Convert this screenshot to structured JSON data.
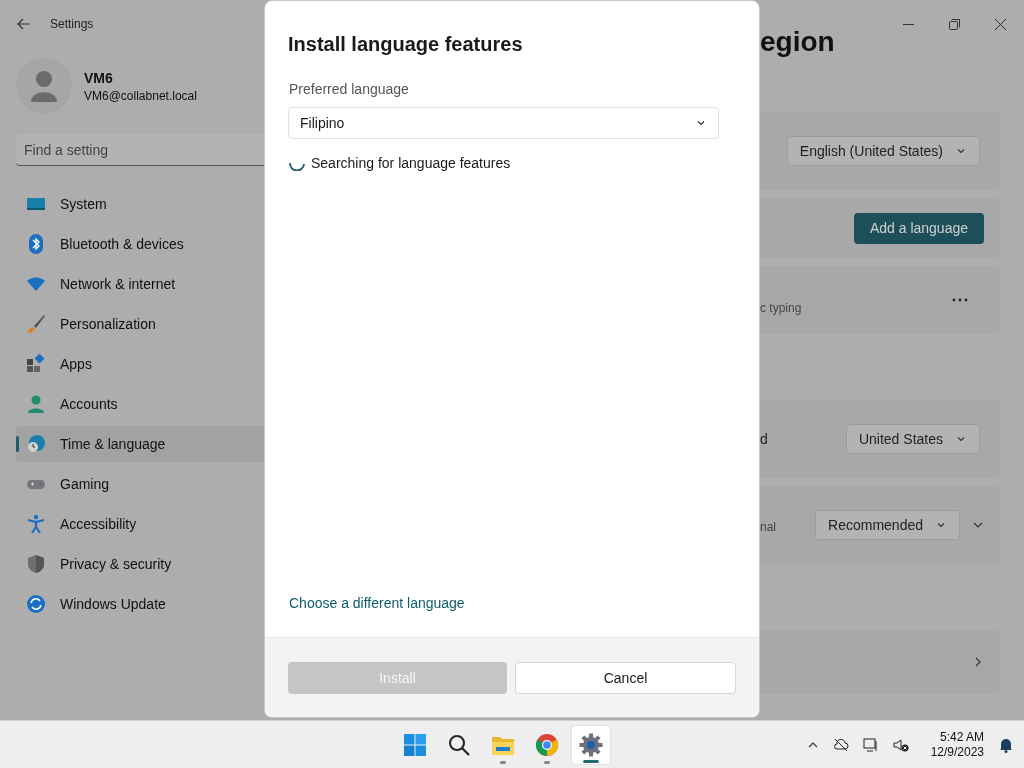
{
  "window": {
    "title": "Settings"
  },
  "user": {
    "name": "VM6",
    "email": "VM6@collabnet.local"
  },
  "search": {
    "placeholder": "Find a setting"
  },
  "sidebar": {
    "items": [
      {
        "label": "System",
        "kind": "system",
        "selected": false
      },
      {
        "label": "Bluetooth & devices",
        "kind": "bluetooth",
        "selected": false
      },
      {
        "label": "Network & internet",
        "kind": "network",
        "selected": false
      },
      {
        "label": "Personalization",
        "kind": "brush",
        "selected": false
      },
      {
        "label": "Apps",
        "kind": "apps",
        "selected": false
      },
      {
        "label": "Accounts",
        "kind": "accounts",
        "selected": false
      },
      {
        "label": "Time & language",
        "kind": "time",
        "selected": true
      },
      {
        "label": "Gaming",
        "kind": "gaming",
        "selected": false
      },
      {
        "label": "Accessibility",
        "kind": "accessibility",
        "selected": false
      },
      {
        "label": "Privacy & security",
        "kind": "privacy",
        "selected": false
      },
      {
        "label": "Windows Update",
        "kind": "update",
        "selected": false
      }
    ]
  },
  "page": {
    "title": "egion",
    "cards": [
      {
        "kind": "dropdown",
        "value": "English (United States)"
      },
      {
        "kind": "button",
        "value": "Add a language"
      },
      {
        "kind": "more",
        "text": "c typing"
      },
      {
        "kind": "gap"
      },
      {
        "kind": "dropdown",
        "text": "d",
        "value": "United States"
      },
      {
        "kind": "expand",
        "text": "nal",
        "value": "Recommended"
      },
      {
        "kind": "gap"
      },
      {
        "kind": "link"
      }
    ]
  },
  "dialog": {
    "title": "Install language features",
    "field_label": "Preferred language",
    "language": "Filipino",
    "status": "Searching for language features",
    "link": "Choose a different language",
    "buttons": [
      {
        "label": "Install",
        "disabled": true,
        "primary": true
      },
      {
        "label": "Cancel",
        "disabled": false,
        "primary": false
      }
    ]
  },
  "taskbar": {
    "apps": [
      {
        "kind": "start",
        "running": false,
        "selected": false
      },
      {
        "kind": "search",
        "running": false,
        "selected": false
      },
      {
        "kind": "explorer",
        "running": true,
        "selected": false
      },
      {
        "kind": "chrome",
        "running": true,
        "selected": false
      },
      {
        "kind": "settings",
        "running": true,
        "selected": true
      }
    ],
    "time": "5:42 AM",
    "date": "12/9/2023"
  }
}
